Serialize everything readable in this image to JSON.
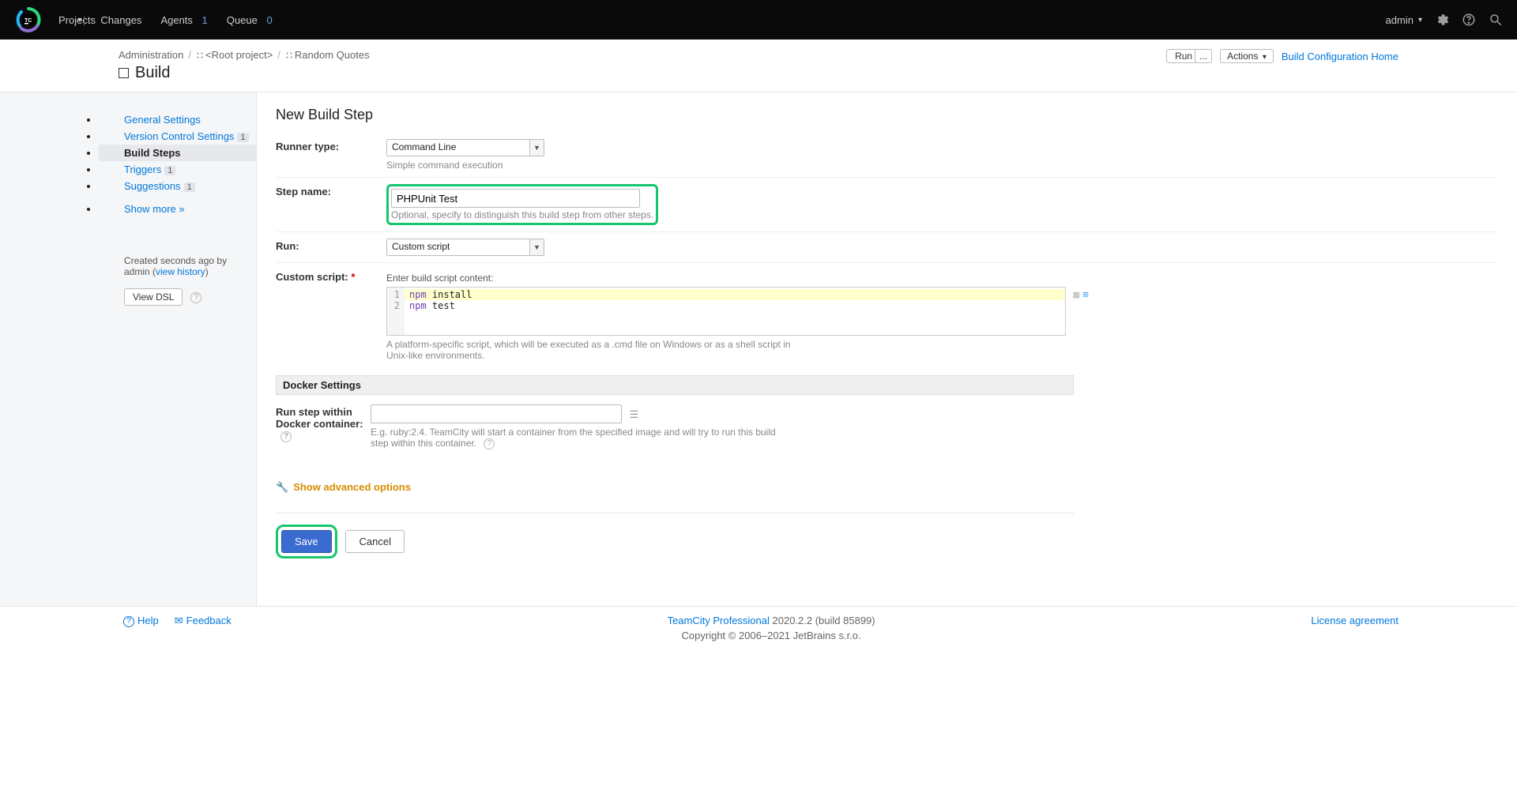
{
  "nav": {
    "projects": "Projects",
    "changes": "Changes",
    "agents": "Agents",
    "agents_count": "1",
    "queue": "Queue",
    "queue_count": "0",
    "admin_user": "admin"
  },
  "breadcrumb": {
    "administration": "Administration",
    "root_project": "<Root project>",
    "project": "Random Quotes"
  },
  "page_title": "Build",
  "head_actions": {
    "run": "Run",
    "split": "...",
    "actions": "Actions",
    "config_home": "Build Configuration Home"
  },
  "sidebar": {
    "items": [
      {
        "label": "General Settings",
        "badge": ""
      },
      {
        "label": "Version Control Settings",
        "badge": "1"
      },
      {
        "label": "Build Steps",
        "badge": "",
        "active": true
      },
      {
        "label": "Triggers",
        "badge": "1"
      },
      {
        "label": "Suggestions",
        "badge": "1"
      }
    ],
    "show_more": "Show more »",
    "created_prefix": "Created seconds ago by admin (",
    "view_history": "view history",
    "created_suffix": ")",
    "view_dsl": "View DSL"
  },
  "heading": "New Build Step",
  "form": {
    "runner_label": "Runner type:",
    "runner_value": "Command Line",
    "runner_hint": "Simple command execution",
    "step_label": "Step name:",
    "step_value": "PHPUnit Test",
    "step_hint": "Optional, specify to distinguish this build step from other steps.",
    "run_label": "Run:",
    "run_value": "Custom script",
    "script_label": "Custom script:",
    "script_prompt": "Enter build script content:",
    "script_line1_kw": "npm",
    "script_line1_rest": " install",
    "script_line2_kw": "npm",
    "script_line2_rest": " test",
    "script_hint": "A platform-specific script, which will be executed as a .cmd file on Windows or as a shell script in Unix-like environments.",
    "docker_section": "Docker Settings",
    "docker_label": "Run step within Docker container:",
    "docker_hint": "E.g. ruby:2.4. TeamCity will start a container from the specified image and will try to run this build step within this container.",
    "advanced": "Show advanced options",
    "save": "Save",
    "cancel": "Cancel"
  },
  "footer": {
    "help": "Help",
    "feedback": "Feedback",
    "product": "TeamCity Professional",
    "version": " 2020.2.2 (build 85899)",
    "copyright": "Copyright © 2006–2021 JetBrains s.r.o.",
    "license": "License agreement"
  }
}
